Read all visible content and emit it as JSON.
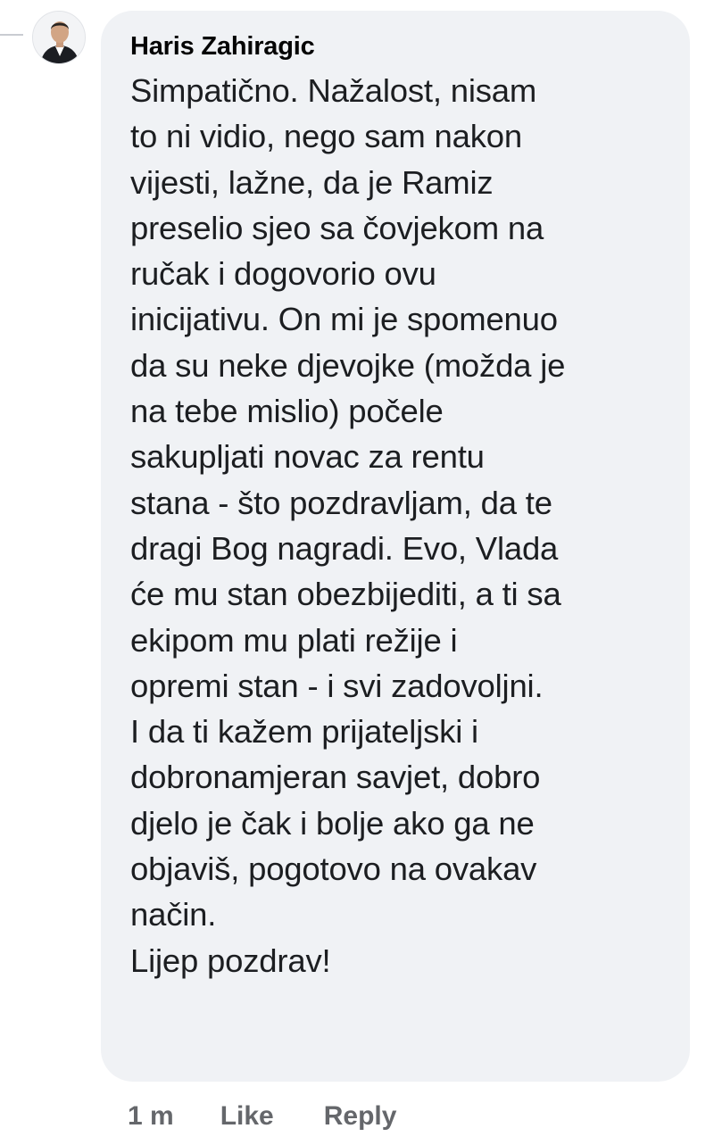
{
  "comment": {
    "author": "Haris Zahiragic",
    "avatar_icon": "user-avatar-icon",
    "lines": [
      "Simpatično. Nažalost, nisam",
      "to ni vidio, nego sam nakon",
      "vijesti, lažne, da je Ramiz",
      "preselio sjeo sa čovjekom na",
      "ručak i dogovorio ovu",
      "inicijativu. On mi je spomenuo",
      "da su neke djevojke (možda je",
      "na tebe mislio) počele",
      "sakupljati novac za rentu",
      "stana - što pozdravljam, da te",
      "dragi Bog nagradi. Evo, Vlada",
      "će mu stan obezbijediti, a ti sa",
      "ekipom mu plati režije i",
      "opremi stan - i svi zadovoljni.",
      "I da ti kažem prijateljski i",
      "dobronamjeran savjet, dobro",
      "djelo je čak i bolje ako ga ne",
      "objaviš, pogotovo na ovakav",
      "način.",
      "Lijep pozdrav!"
    ]
  },
  "actions": {
    "timestamp": "1 m",
    "like_label": "Like",
    "reply_label": "Reply"
  },
  "colors": {
    "bubble_bg": "#f0f2f5",
    "text": "#1c1e21",
    "meta": "#65676b"
  }
}
